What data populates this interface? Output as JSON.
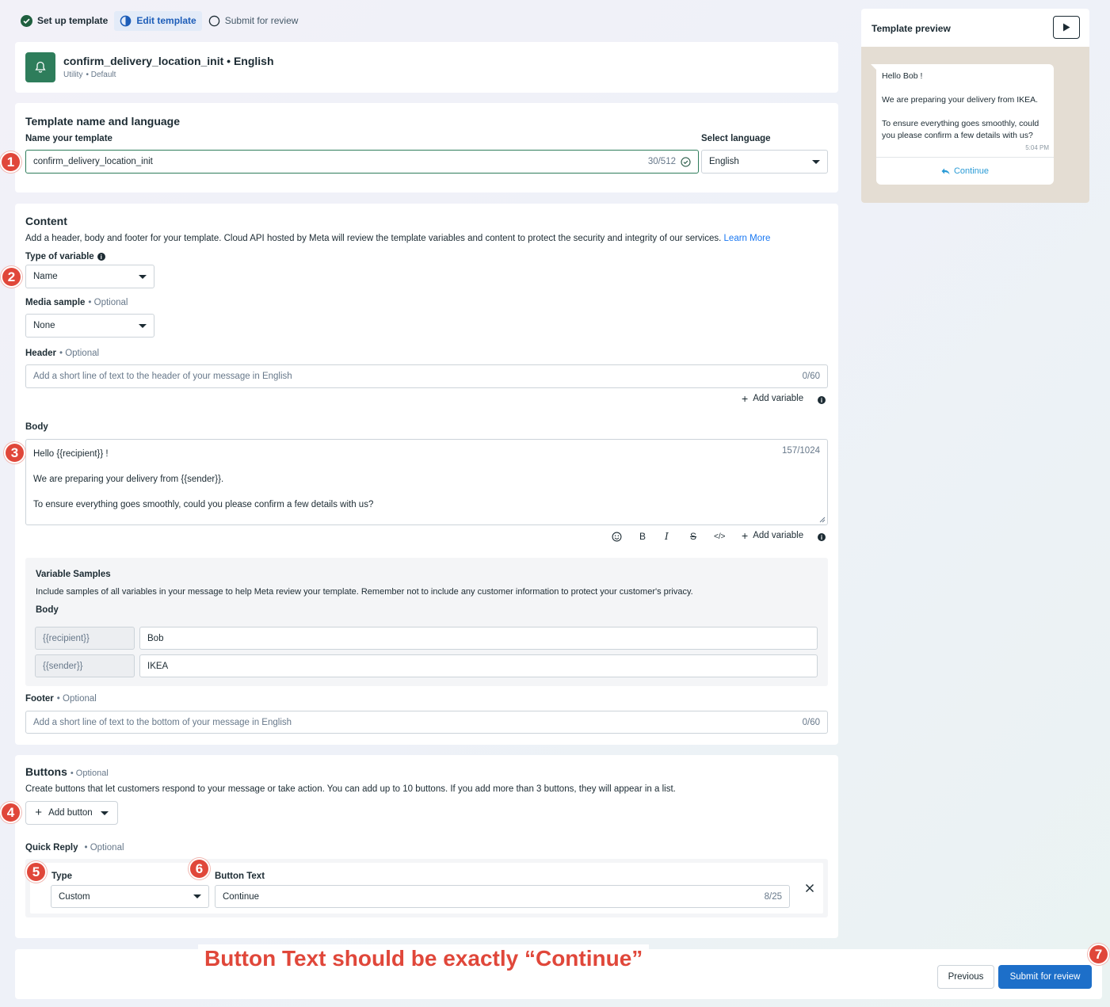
{
  "steps": [
    {
      "label": "Set up template",
      "state": "done"
    },
    {
      "label": "Edit template",
      "state": "active"
    },
    {
      "label": "Submit for review",
      "state": "todo"
    }
  ],
  "template_header": {
    "title": "confirm_delivery_location_init • English",
    "category": "Utility",
    "subtype": "• Default"
  },
  "name_section": {
    "title": "Template name and language",
    "name_label": "Name your template",
    "name_value": "confirm_delivery_location_init",
    "name_counter": "30/512",
    "language_label": "Select language",
    "language_value": "English"
  },
  "content": {
    "title": "Content",
    "description": "Add a header, body and footer for your template. Cloud API hosted by Meta will review the template variables and content to protect the security and integrity of our services.",
    "learn_more": "Learn More",
    "variable_type_label": "Type of variable",
    "variable_type_value": "Name",
    "media_label": "Media sample",
    "media_optional": "• Optional",
    "media_value": "None",
    "header_label": "Header",
    "header_optional": "• Optional",
    "header_placeholder": "Add a short line of text to the header of your message in English",
    "header_counter": "0/60",
    "add_variable": "Add variable",
    "body_label": "Body",
    "body_line1": "Hello {{recipient}} !",
    "body_line2": "We are preparing your delivery from {{sender}}.",
    "body_line3": "To ensure everything goes smoothly, could you please confirm a few details with us?",
    "body_counter": "157/1024",
    "toolbar": {
      "bold": "B",
      "italic": "I",
      "strike": "S",
      "code": "</>"
    },
    "samples_title": "Variable Samples",
    "samples_desc": "Include samples of all variables in your message to help Meta review your template. Remember not to include any customer information to protect your customer's privacy.",
    "samples_body_label": "Body",
    "samples": [
      {
        "var": "{{recipient}}",
        "value": "Bob"
      },
      {
        "var": "{{sender}}",
        "value": "IKEA"
      }
    ],
    "footer_label": "Footer",
    "footer_optional": "• Optional",
    "footer_placeholder": "Add a short line of text to the bottom of your message in English",
    "footer_counter": "0/60"
  },
  "buttons": {
    "title": "Buttons",
    "optional": "• Optional",
    "description": "Create buttons that let customers respond to your message or take action. You can add up to 10 buttons. If you add more than 3 buttons, they will appear in a list.",
    "add_button": "Add button",
    "quick_reply_label": "Quick Reply",
    "quick_reply_optional": "• Optional",
    "type_label": "Type",
    "type_value": "Custom",
    "text_label": "Button Text",
    "text_value": "Continue",
    "text_counter": "8/25"
  },
  "preview": {
    "title": "Template preview",
    "line1": "Hello Bob !",
    "line2": "We are preparing your delivery from IKEA.",
    "line3": "To ensure everything goes smoothly, could you please confirm a few details with us?",
    "time": "5:04 PM",
    "button": "Continue"
  },
  "footer_bar": {
    "previous": "Previous",
    "submit": "Submit for review"
  },
  "annotation_text": "Button Text should be exactly “Continue”",
  "badges": [
    "1",
    "2",
    "3",
    "4",
    "5",
    "6",
    "7"
  ],
  "colors": {
    "accent": "#1877f2",
    "primary_button": "#1d6fc9",
    "badge": "#e0473a",
    "icon_bg": "#2e7d5b"
  }
}
